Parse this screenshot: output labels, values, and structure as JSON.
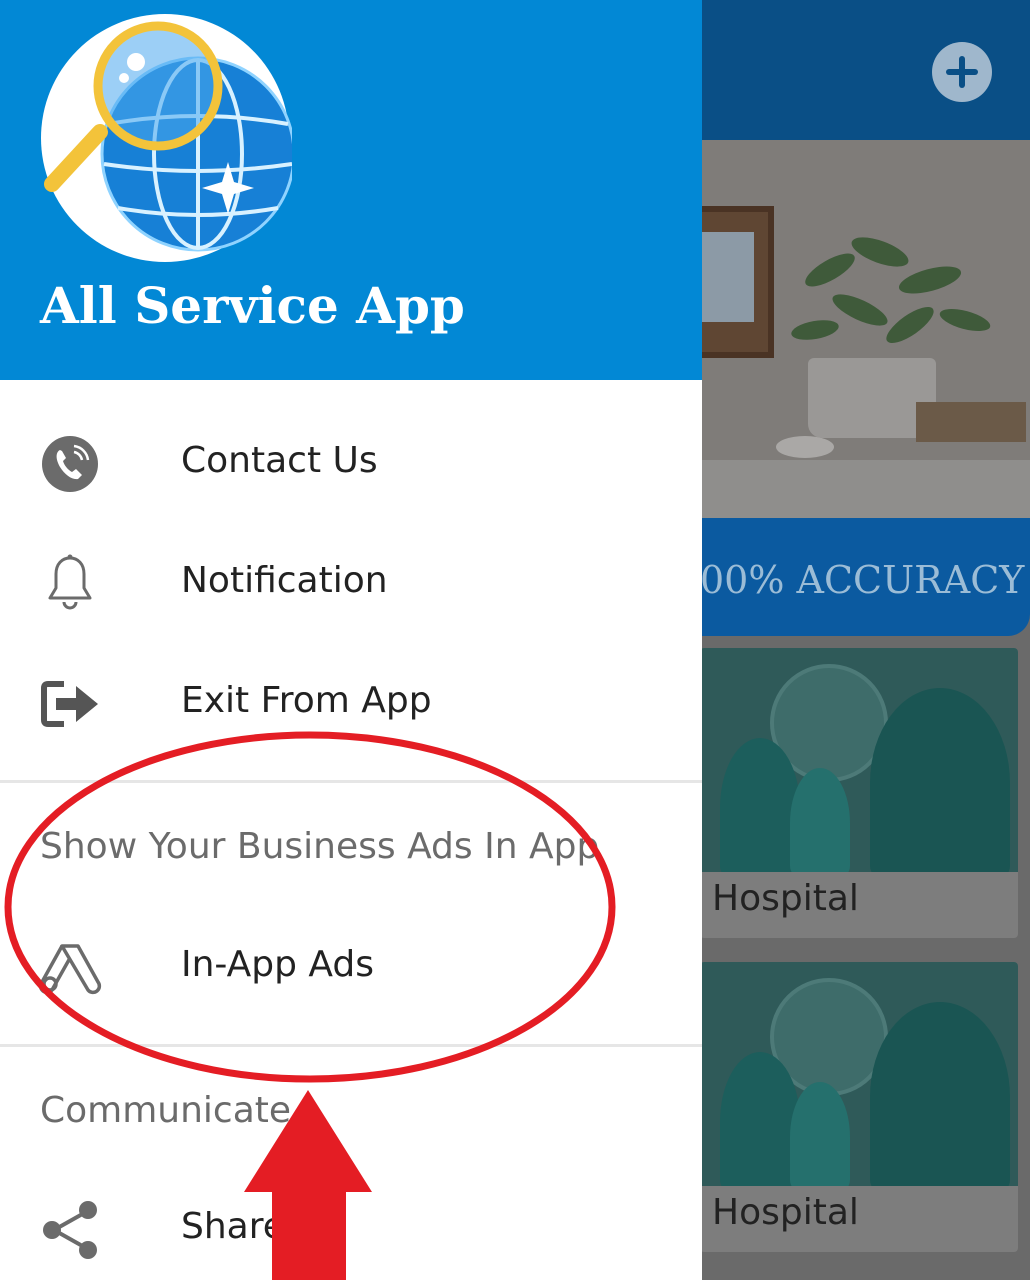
{
  "drawer": {
    "title": "All Service App",
    "items": [
      {
        "label": "Contact Us",
        "icon": "phone-icon"
      },
      {
        "label": "Notification",
        "icon": "bell-icon"
      },
      {
        "label": "Exit From App",
        "icon": "exit-icon"
      }
    ],
    "section_ads": {
      "header": "Show Your Business Ads In App",
      "items": [
        {
          "label": "In-App Ads",
          "icon": "ads-icon"
        }
      ]
    },
    "section_communicate": {
      "header": "Communicate",
      "items": [
        {
          "label": "Share",
          "icon": "share-icon"
        }
      ]
    }
  },
  "background": {
    "ribbon_text": "00% ACCURACY",
    "cards": [
      {
        "label": "Hospital"
      },
      {
        "label": "Hospital"
      }
    ]
  },
  "colors": {
    "drawer_header": "#0288d5",
    "annotation": "#e41d24",
    "scrim": "#6a6a6a"
  }
}
